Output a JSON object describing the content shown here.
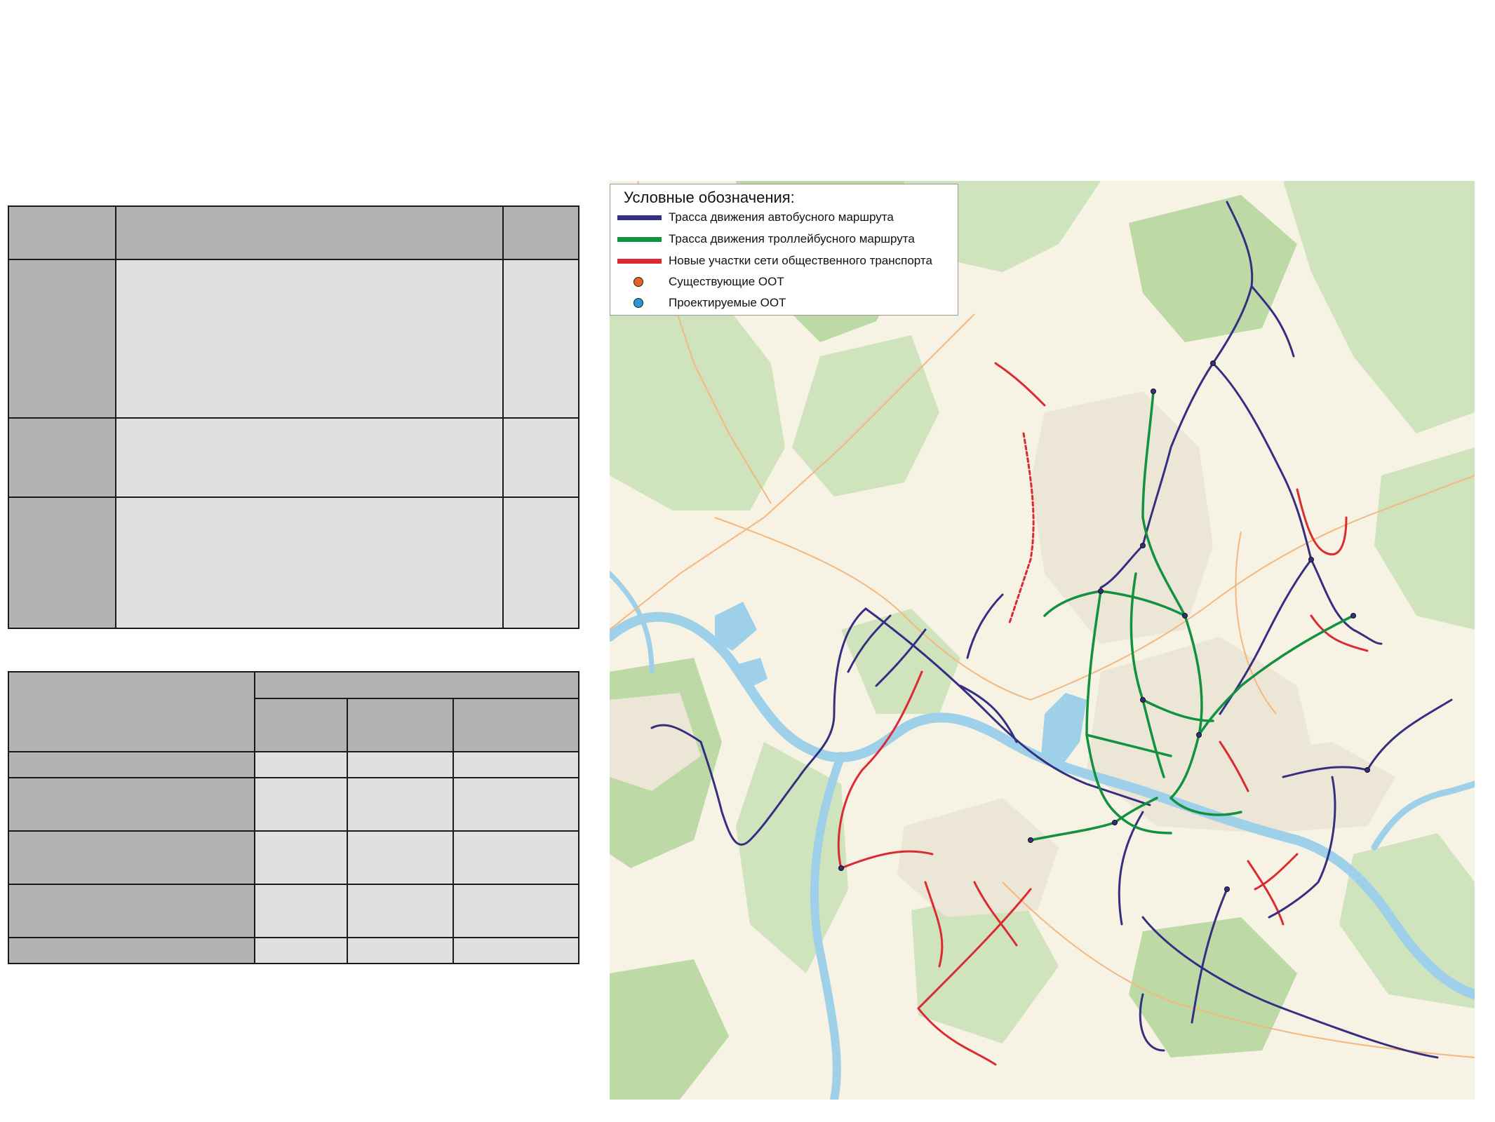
{
  "legend": {
    "title": "Условные обозначения:",
    "items": [
      {
        "label": "Трасса движения автобусного маршрута",
        "kind": "line",
        "color": "#352f82",
        "icon": "bus-route-line"
      },
      {
        "label": "Трасса движения троллейбусного маршрута",
        "kind": "line",
        "color": "#12913e",
        "icon": "trolleybus-route-line"
      },
      {
        "label": "Новые участки сети общественного транспорта",
        "kind": "line",
        "color": "#dc2a32",
        "icon": "new-network-line"
      },
      {
        "label": "Существующие ООТ",
        "kind": "dot",
        "color": "#e8631f",
        "icon": "existing-stop-dot"
      },
      {
        "label": "Проектируемые ООТ",
        "kind": "dot",
        "color": "#2b96d6",
        "icon": "planned-stop-dot"
      }
    ]
  },
  "map_colors": {
    "land": "#f6f2e4",
    "forest": "#cfe3bd",
    "forest_dark": "#bcd9a6",
    "water": "#9fd0ea",
    "urban": "#ece6d6",
    "road": "#f3b880",
    "bus": "#352f82",
    "trolleybus": "#12913e",
    "new": "#dc2a32"
  },
  "table_top": {
    "columns": 3,
    "rows": 4,
    "cells": []
  },
  "table_bottom": {
    "columns": 4,
    "rows": 7,
    "cells": []
  }
}
